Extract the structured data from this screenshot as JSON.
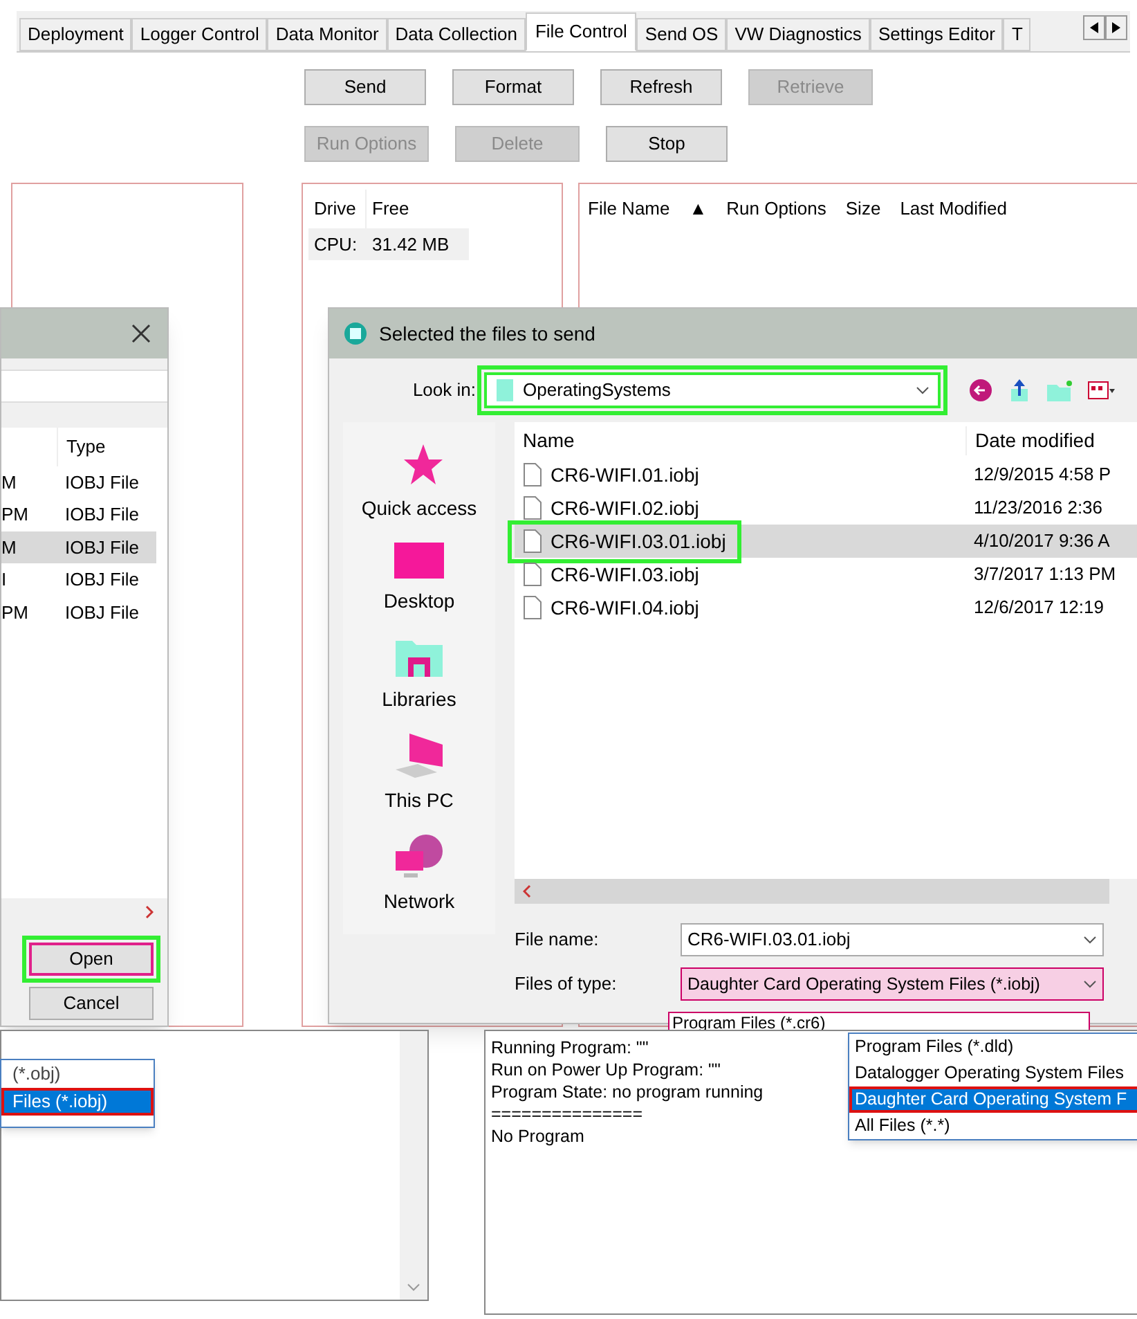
{
  "tabs": [
    {
      "label": "Deployment",
      "selected": false
    },
    {
      "label": "Logger Control",
      "selected": false
    },
    {
      "label": "Data Monitor",
      "selected": false
    },
    {
      "label": "Data Collection",
      "selected": false
    },
    {
      "label": "File Control",
      "selected": true
    },
    {
      "label": "Send OS",
      "selected": false
    },
    {
      "label": "VW Diagnostics",
      "selected": false
    },
    {
      "label": "Settings Editor",
      "selected": false
    },
    {
      "label": "T",
      "selected": false
    }
  ],
  "toolbar": [
    [
      {
        "label": "Send",
        "disabled": false
      },
      {
        "label": "Format",
        "disabled": false
      },
      {
        "label": "Refresh",
        "disabled": false
      },
      {
        "label": "Retrieve",
        "disabled": true
      }
    ],
    [
      {
        "label": "Run Options",
        "disabled": true
      },
      {
        "label": "Delete",
        "disabled": true
      },
      {
        "label": "Stop",
        "disabled": false
      }
    ]
  ],
  "drive_table": {
    "columns": [
      "Drive",
      "Free"
    ],
    "rows": [
      [
        "CPU:",
        "31.42 MB"
      ]
    ]
  },
  "file_table": {
    "columns": [
      "File Name",
      "▲",
      "Run Options",
      "Size",
      "Last Modified"
    ]
  },
  "back_dialog": {
    "columns": [
      "",
      "Type"
    ],
    "rows": [
      {
        "cells": [
          "M",
          "IOBJ File"
        ],
        "selected": false
      },
      {
        "cells": [
          "PM",
          "IOBJ File"
        ],
        "selected": false
      },
      {
        "cells": [
          "M",
          "IOBJ File"
        ],
        "selected": true
      },
      {
        "cells": [
          "I",
          "IOBJ File"
        ],
        "selected": false
      },
      {
        "cells": [
          "PM",
          "IOBJ File"
        ],
        "selected": false
      }
    ],
    "buttons": [
      {
        "label": "Open",
        "outlined": true
      },
      {
        "label": "Cancel",
        "outlined": false
      }
    ]
  },
  "open_dialog": {
    "title": "Selected the files to send",
    "look_in_label": "Look in:",
    "look_in": "OperatingSystems",
    "look_in_outlined": true,
    "places": [
      {
        "kind": "star",
        "label": "Quick access"
      },
      {
        "kind": "desktop",
        "label": "Desktop"
      },
      {
        "kind": "libraries",
        "label": "Libraries"
      },
      {
        "kind": "pc",
        "label": "This PC"
      },
      {
        "kind": "network",
        "label": "Network"
      }
    ],
    "columns": [
      "Name",
      "Date modified"
    ],
    "files": [
      {
        "name": "CR6-WIFI.01.iobj",
        "date": "12/9/2015 4:58 P",
        "selected": false,
        "outlined": false
      },
      {
        "name": "CR6-WIFI.02.iobj",
        "date": "11/23/2016 2:36",
        "selected": false,
        "outlined": false
      },
      {
        "name": "CR6-WIFI.03.01.iobj",
        "date": "4/10/2017 9:36 A",
        "selected": true,
        "outlined": true
      },
      {
        "name": "CR6-WIFI.03.iobj",
        "date": "3/7/2017 1:13 PM",
        "selected": false,
        "outlined": false
      },
      {
        "name": "CR6-WIFI.04.iobj",
        "date": "12/6/2017 12:19",
        "selected": false,
        "outlined": false
      }
    ],
    "file_name_label": "File name:",
    "file_name": "CR6-WIFI.03.01.iobj",
    "file_type_label": "Files of type:",
    "file_type": "Daughter Card Operating System Files (*.iobj)",
    "type_list": [
      "Program Files (*.cr6)"
    ],
    "type_popup": [
      {
        "label": "Program Files (*.dld)",
        "selected": false,
        "outlined": false
      },
      {
        "label": "Datalogger Operating System Files",
        "selected": false,
        "outlined": false
      },
      {
        "label": "Daughter Card Operating System F",
        "selected": true,
        "outlined": true
      },
      {
        "label": "All Files (*.*)",
        "selected": false,
        "outlined": false
      }
    ]
  },
  "back_type_list": [
    {
      "label": "(*.obj)",
      "selected": false,
      "outlined": false
    },
    {
      "label": "Files (*.iobj)",
      "selected": true,
      "outlined": true
    }
  ],
  "status_log": [
    "Running Program: \"\"",
    "Run on Power Up Program: \"\"",
    "Program State: no program running",
    "===============",
    "No Program"
  ]
}
